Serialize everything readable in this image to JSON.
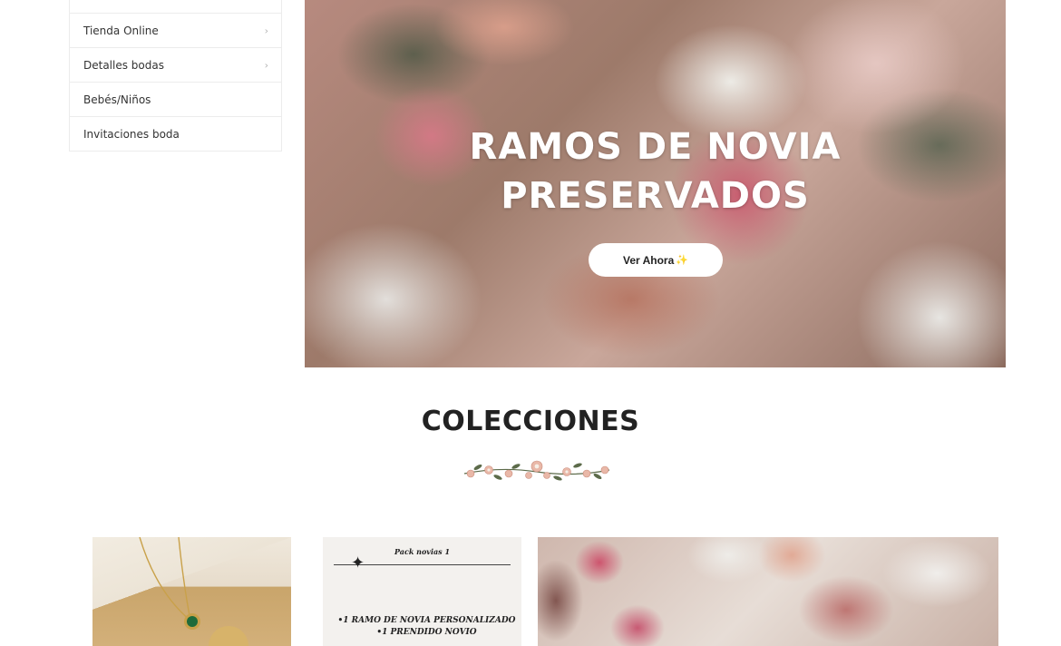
{
  "sidebar": {
    "items": [
      {
        "label": "Tienda Online",
        "has_submenu": true
      },
      {
        "label": "Detalles bodas",
        "has_submenu": true
      },
      {
        "label": "Bebés/Niños",
        "has_submenu": false
      },
      {
        "label": "Invitaciones boda",
        "has_submenu": false
      }
    ],
    "chevron": "›"
  },
  "hero": {
    "title_line1": "RAMOS DE NOVIA",
    "title_line2": "PRESERVADOS",
    "button_label": "Ver Ahora",
    "button_emoji": "✨"
  },
  "collections": {
    "title": "COLECCIONES",
    "cards": [
      {
        "image": "necklace-photo"
      },
      {
        "image": "pack-card",
        "pack_title": "Pack novias 1",
        "pack_line1": "•1 RAMO DE NOVIA PERSONALIZADO",
        "pack_line2": "•1 PRENDIDO NOVIO"
      },
      {
        "image": "bouquet-photo"
      }
    ]
  },
  "colors": {
    "accent_white": "#ffffff",
    "text_dark": "#222222",
    "border": "#ececec"
  }
}
